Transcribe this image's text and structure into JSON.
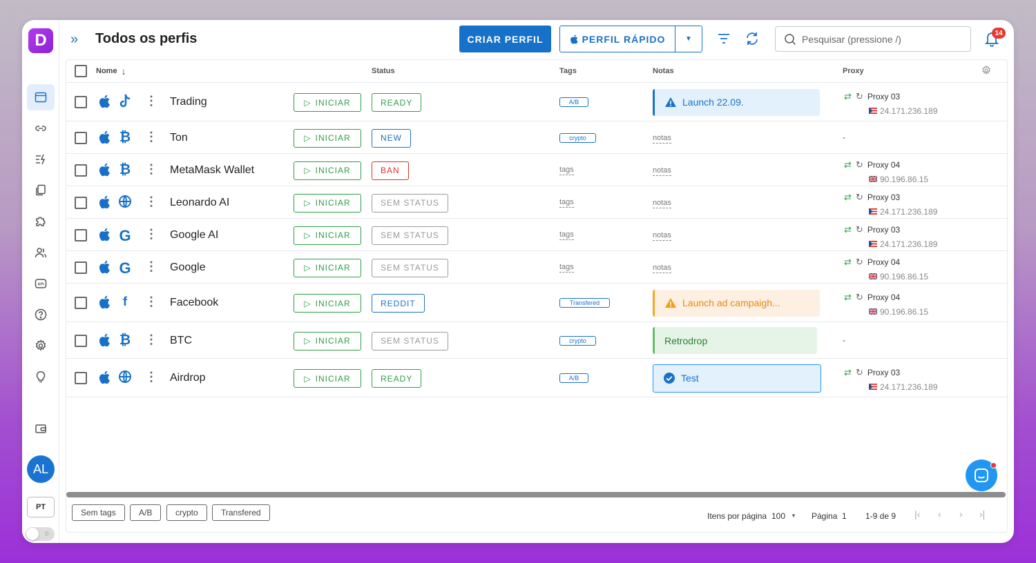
{
  "header": {
    "title": "Todos os perfis",
    "create_label": "CRIAR PERFIL",
    "quick_label": "PERFIL RÁPIDO",
    "search_placeholder": "Pesquisar (pressione /)",
    "notifications": "14"
  },
  "sidebar": {
    "logo": "D",
    "avatar": "AL",
    "lang": "PT"
  },
  "columns": {
    "name": "Nome",
    "status": "Status",
    "tags": "Tags",
    "notes": "Notas",
    "proxy": "Proxy"
  },
  "rows": [
    {
      "name": "Trading",
      "start": "INICIAR",
      "status": "READY",
      "tag": "A/B",
      "note": "Launch 22.09.",
      "proxy": "Proxy 03",
      "ip": "24.171.236.189"
    },
    {
      "name": "Ton",
      "start": "INICIAR",
      "status": "NEW",
      "tag": "crypto",
      "note": "notas",
      "proxy": "-",
      "ip": ""
    },
    {
      "name": "MetaMask Wallet",
      "start": "INICIAR",
      "status": "BAN",
      "tag": "tags",
      "note": "notas",
      "proxy": "Proxy 04",
      "ip": "90.196.86.15"
    },
    {
      "name": "Leonardo AI",
      "start": "INICIAR",
      "status": "SEM STATUS",
      "tag": "tags",
      "note": "notas",
      "proxy": "Proxy 03",
      "ip": "24.171.236.189"
    },
    {
      "name": "Google AI",
      "start": "INICIAR",
      "status": "SEM STATUS",
      "tag": "tags",
      "note": "notas",
      "proxy": "Proxy 03",
      "ip": "24.171.236.189"
    },
    {
      "name": "Google",
      "start": "INICIAR",
      "status": "SEM STATUS",
      "tag": "tags",
      "note": "notas",
      "proxy": "Proxy 04",
      "ip": "90.196.86.15"
    },
    {
      "name": "Facebook",
      "start": "INICIAR",
      "status": "REDDIT",
      "tag": "Transfered",
      "note": "Launch ad campaigh...",
      "proxy": "Proxy 04",
      "ip": "90.196.86.15"
    },
    {
      "name": "BTC",
      "start": "INICIAR",
      "status": "SEM STATUS",
      "tag": "crypto",
      "note": "Retrodrop",
      "proxy": "-",
      "ip": ""
    },
    {
      "name": "Airdrop",
      "start": "INICIAR",
      "status": "READY",
      "tag": "A/B",
      "note": "Test",
      "proxy": "Proxy 03",
      "ip": "24.171.236.189"
    }
  ],
  "footer": {
    "chips": [
      "Sem tags",
      "A/B",
      "crypto",
      "Transfered"
    ],
    "per_page_label": "Itens por página",
    "per_page_value": "100",
    "page_label": "Página",
    "page_value": "1",
    "range": "1-9 de 9"
  },
  "colors": {
    "accent": "#1871c9",
    "green": "#2e9d46",
    "red": "#d93025",
    "grey": "#888888"
  }
}
